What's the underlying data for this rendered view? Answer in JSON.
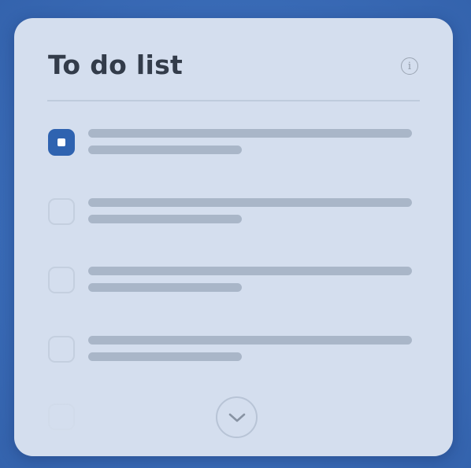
{
  "widget": {
    "title": "To do list",
    "info_icon": "info-icon",
    "info_glyph": "i",
    "expand_icon": "chevron-down-icon"
  },
  "todo_items": [
    {
      "checked": true
    },
    {
      "checked": false
    },
    {
      "checked": false
    },
    {
      "checked": false
    },
    {
      "checked": false
    }
  ],
  "colors": {
    "background": "#3a6cb8",
    "card": "#d4deee",
    "accent": "#2f63b0",
    "title": "#333c4a",
    "placeholder_line": "#a9b6c8"
  }
}
